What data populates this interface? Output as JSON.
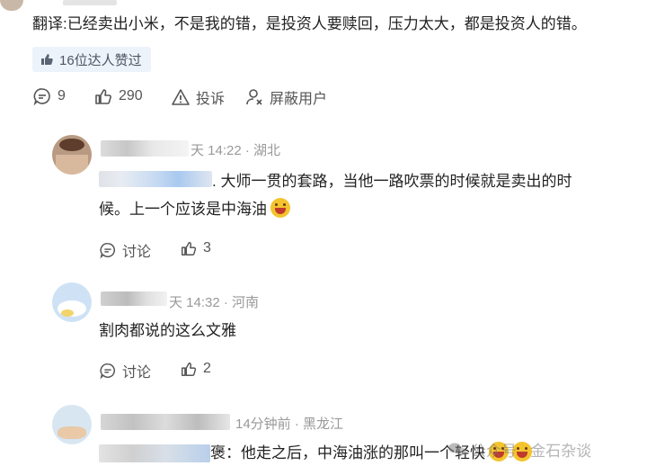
{
  "top_comment": {
    "text": "翻译:已经卖出小米，不是我的错，是投资人要赎回，压力太大，都是投资人的错。",
    "likes_badge": "16位达人赞过",
    "reply_count": "9",
    "like_count": "290",
    "report_label": "投诉",
    "block_label": "屏蔽用户"
  },
  "replies": [
    {
      "meta": "天 14:22 · 湖北",
      "text_line1": ". 大师一贯的套路，当他一路吹票的时候就是卖出的时",
      "text_line2": "候。上一个应该是中海油",
      "discuss_label": "讨论",
      "like_count": "3",
      "emoji": "grinning-face-icon"
    },
    {
      "meta": "天 14:32 · 河南",
      "text": "割肉都说的这么文雅",
      "discuss_label": "讨论",
      "like_count": "2"
    },
    {
      "meta": "14分钟前 · 黑龙江",
      "text": "褒：他走之后，中海油涨的那叫一个轻快",
      "emoji": "grinning-face-icon"
    }
  ],
  "watermark": "公众号 · 金石杂谈",
  "colors": {
    "badge_bg": "#edf3fb",
    "meta_gray": "#999999",
    "emoji_yellow": "#f3c42d"
  }
}
